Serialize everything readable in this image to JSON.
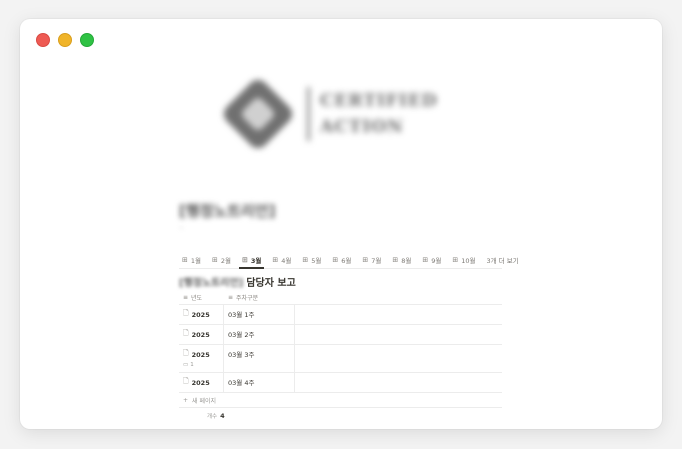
{
  "window": {
    "controls": [
      "close",
      "minimize",
      "maximize"
    ]
  },
  "logo": {
    "line1": "CERTIFIED",
    "line2": "ACTION"
  },
  "page": {
    "title": "[행정노트리언]",
    "subtitle": "-"
  },
  "tabs": [
    {
      "label": "1월",
      "icon": "table-icon",
      "active": false
    },
    {
      "label": "2월",
      "icon": "table-icon",
      "active": false
    },
    {
      "label": "3월",
      "icon": "table-icon",
      "active": true
    },
    {
      "label": "4월",
      "icon": "table-icon",
      "active": false
    },
    {
      "label": "5월",
      "icon": "table-icon",
      "active": false
    },
    {
      "label": "6월",
      "icon": "table-icon",
      "active": false
    },
    {
      "label": "7월",
      "icon": "table-icon",
      "active": false
    },
    {
      "label": "8월",
      "icon": "table-icon",
      "active": false
    },
    {
      "label": "9월",
      "icon": "table-icon",
      "active": false
    },
    {
      "label": "10월",
      "icon": "table-icon",
      "active": false
    }
  ],
  "tabs_more": "3개 더 보기",
  "database": {
    "title_prefix": "[행정노트리언]",
    "title": "담당자 보고",
    "columns": [
      {
        "label": "년도",
        "icon": "text-icon"
      },
      {
        "label": "주차구분",
        "icon": "text-icon"
      }
    ],
    "rows": [
      {
        "year": "2025",
        "week": "03월 1주",
        "comments": ""
      },
      {
        "year": "2025",
        "week": "03월 2주",
        "comments": ""
      },
      {
        "year": "2025",
        "week": "03월 3주",
        "comments": "1"
      },
      {
        "year": "2025",
        "week": "03월 4주",
        "comments": ""
      }
    ],
    "new_page": "새 페이지",
    "count_label": "개수",
    "count_value": "4"
  }
}
